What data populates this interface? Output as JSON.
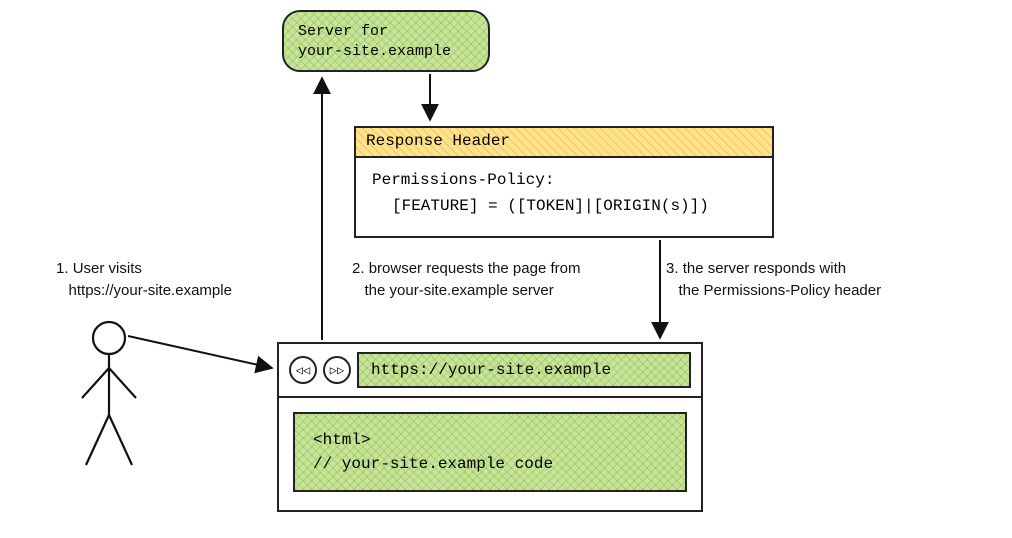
{
  "server": {
    "line1": "Server for",
    "line2": "your-site.example"
  },
  "response": {
    "header_label": "Response Header",
    "policy_name": "Permissions-Policy:",
    "policy_syntax": "[FEATURE] = ([TOKEN]|[ORIGIN(s)])"
  },
  "captions": {
    "c1_num": "1.",
    "c1_text": "User visits",
    "c1_url": "https://your-site.example",
    "c2_num": "2.",
    "c2_text1": "browser requests the page from",
    "c2_text2": "the your-site.example server",
    "c3_num": "3.",
    "c3_text1": "the server responds with",
    "c3_text2": "the Permissions-Policy header"
  },
  "browser": {
    "back_icon": "◁◁",
    "fwd_icon": "▷▷",
    "url": "https://your-site.example",
    "code_line1": "<html>",
    "code_line2": "// your-site.example code"
  }
}
